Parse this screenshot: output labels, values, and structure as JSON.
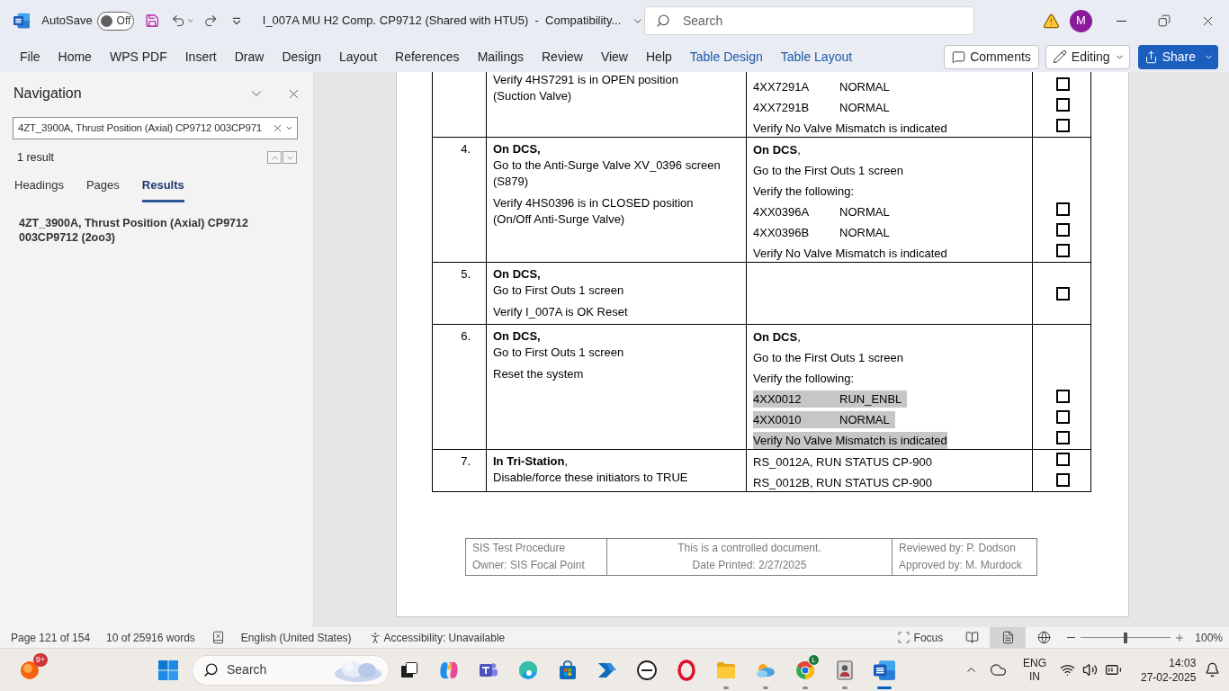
{
  "title_bar": {
    "autosave_label": "AutoSave",
    "autosave": {
      "on": false,
      "label": "Off"
    },
    "document_title": "I_007A MU H2 Comp. CP9712 (Shared with HTU5)  -  Compatibility...",
    "search": {
      "placeholder": "Search"
    },
    "avatar": "M"
  },
  "ribbon": {
    "tabs": [
      {
        "label": "File",
        "kind": "standard"
      },
      {
        "label": "Home",
        "kind": "standard"
      },
      {
        "label": "WPS PDF",
        "kind": "standard"
      },
      {
        "label": "Insert",
        "kind": "standard"
      },
      {
        "label": "Draw",
        "kind": "standard"
      },
      {
        "label": "Design",
        "kind": "standard"
      },
      {
        "label": "Layout",
        "kind": "standard"
      },
      {
        "label": "References",
        "kind": "standard"
      },
      {
        "label": "Mailings",
        "kind": "standard"
      },
      {
        "label": "Review",
        "kind": "standard"
      },
      {
        "label": "View",
        "kind": "standard"
      },
      {
        "label": "Help",
        "kind": "standard"
      },
      {
        "label": "Table Design",
        "kind": "contextual"
      },
      {
        "label": "Table Layout",
        "kind": "contextual"
      }
    ],
    "comments": "Comments",
    "editing": "Editing",
    "share": "Share"
  },
  "navigation": {
    "title": "Navigation",
    "search": {
      "value": "4ZT_3900A, Thrust Position (Axial) CP9712 003CP971"
    },
    "result_count": "1 result",
    "tabs": [
      {
        "label": "Headings",
        "selected": false
      },
      {
        "label": "Pages",
        "selected": false
      },
      {
        "label": "Results",
        "selected": true
      }
    ],
    "results": [
      "4ZT_3900A, Thrust Position (Axial) CP9712 003CP9712 (2oo3)"
    ]
  },
  "document": {
    "table": {
      "rows": [
        {
          "kind": "continued",
          "step": [
            {
              "text": "Verify 4HS7291 is in OPEN position\n(Suction Valve)",
              "bold": false
            }
          ],
          "expected": [
            {
              "kind": "signal",
              "tag": "4XX7291A",
              "value": "NORMAL",
              "checked": false,
              "selected": false
            },
            {
              "kind": "signal",
              "tag": "4XX7291B",
              "value": "NORMAL",
              "checked": false,
              "selected": false
            },
            {
              "kind": "text",
              "text": "Verify No Valve Mismatch is indicated",
              "checked": false,
              "selected": false
            }
          ]
        },
        {
          "kind": "step",
          "number": "4.",
          "step": [
            {
              "text": "On DCS,",
              "bold": true
            },
            {
              "text": "Go to the Anti-Surge Valve XV_0396 screen\n(S879)",
              "bold": false
            },
            {
              "text": "Verify 4HS0396 is in CLOSED position\n(On/Off Anti-Surge Valve)",
              "bold": false
            }
          ],
          "expected": [
            {
              "kind": "text",
              "text": "**On DCS**,",
              "selected": false
            },
            {
              "kind": "text",
              "text": "Go to the First Outs 1 screen",
              "selected": false
            },
            {
              "kind": "text",
              "text": "Verify the following:",
              "selected": false
            },
            {
              "kind": "signal",
              "tag": "4XX0396A",
              "value": "NORMAL",
              "checked": false,
              "selected": false
            },
            {
              "kind": "signal",
              "tag": "4XX0396B",
              "value": "NORMAL",
              "checked": false,
              "selected": false
            },
            {
              "kind": "text",
              "text": "Verify No Valve Mismatch is indicated",
              "checked": false,
              "selected": false
            }
          ]
        },
        {
          "kind": "step",
          "number": "5.",
          "step": [
            {
              "text": "On DCS,",
              "bold": true
            },
            {
              "text": "Go to First Outs 1 screen",
              "bold": false
            },
            {
              "text": "Verify I_007A is OK Reset",
              "bold": false
            }
          ],
          "checked": false
        },
        {
          "kind": "step",
          "number": "6.",
          "step": [
            {
              "text": "On DCS,",
              "bold": true
            },
            {
              "text": "Go to First Outs 1 screen",
              "bold": false
            },
            {
              "text": "Reset the system",
              "bold": false
            }
          ],
          "expected": [
            {
              "kind": "text",
              "text": "**On DCS**,",
              "selected": false
            },
            {
              "kind": "text",
              "text": "Go to the First Outs 1 screen",
              "selected": false
            },
            {
              "kind": "text",
              "text": "Verify the following:",
              "selected": false
            },
            {
              "kind": "signal",
              "tag": "4XX0012",
              "value": "RUN_ENBL",
              "checked": false,
              "selected": true
            },
            {
              "kind": "signal",
              "tag": "4XX0010",
              "value": "NORMAL",
              "checked": false,
              "selected": true
            },
            {
              "kind": "text",
              "text": "Verify No Valve Mismatch is indicated",
              "checked": false,
              "selected": true
            }
          ]
        },
        {
          "kind": "step",
          "number": "7.",
          "step": [
            {
              "text": "**In Tri-Station**,",
              "bold": false
            },
            {
              "text": "Disable/force these initiators to TRUE",
              "bold": false
            }
          ],
          "expected": [
            {
              "kind": "text",
              "text": "RS_0012A, RUN STATUS CP-900",
              "checked": false,
              "selected": false
            },
            {
              "kind": "text",
              "text": "RS_0012B, RUN STATUS CP-900",
              "checked": false,
              "selected": false
            }
          ]
        }
      ]
    },
    "footer": [
      {
        "lines": [
          "SIS Test Procedure",
          "Owner: SIS Focal Point"
        ]
      },
      {
        "lines": [
          "This is a controlled document.",
          "Date Printed: 2/27/2025"
        ]
      },
      {
        "lines": [
          "Reviewed by: P. Dodson",
          "Approved by: M. Murdock"
        ]
      }
    ]
  },
  "status_bar": {
    "page": "Page 121 of 154",
    "words": "10 of 25916 words",
    "language": "English (United States)",
    "accessibility": "Accessibility: Unavailable",
    "focus": "Focus",
    "views": [
      {
        "kind": "read",
        "selected": false
      },
      {
        "kind": "print",
        "selected": true
      },
      {
        "kind": "web",
        "selected": false
      }
    ],
    "zoom": {
      "level": 0.5,
      "reading": "100%"
    }
  },
  "taskbar": {
    "widget": {
      "badge": "9+"
    },
    "search": {
      "placeholder": "Search"
    },
    "apps": [
      {
        "kind": "task_view",
        "running": false,
        "selected": false
      },
      {
        "kind": "copilot",
        "running": false,
        "selected": false
      },
      {
        "kind": "teams",
        "running": false,
        "selected": false
      },
      {
        "kind": "edge",
        "running": false,
        "selected": false
      },
      {
        "kind": "store",
        "running": false,
        "selected": false
      },
      {
        "kind": "automate",
        "running": false,
        "selected": false
      },
      {
        "kind": "dell",
        "running": false,
        "selected": false
      },
      {
        "kind": "opera",
        "running": false,
        "selected": false
      },
      {
        "kind": "explorer",
        "running": true,
        "selected": false
      },
      {
        "kind": "cloud_app",
        "running": true,
        "selected": false
      },
      {
        "kind": "chrome",
        "badge": "L",
        "running": true,
        "selected": false
      },
      {
        "kind": "id_app",
        "running": true,
        "selected": false
      },
      {
        "kind": "word",
        "running": true,
        "selected": true
      }
    ],
    "tray": {
      "language": "ENG",
      "region": "IN",
      "time": "14:03",
      "date": "27-02-2025"
    }
  }
}
